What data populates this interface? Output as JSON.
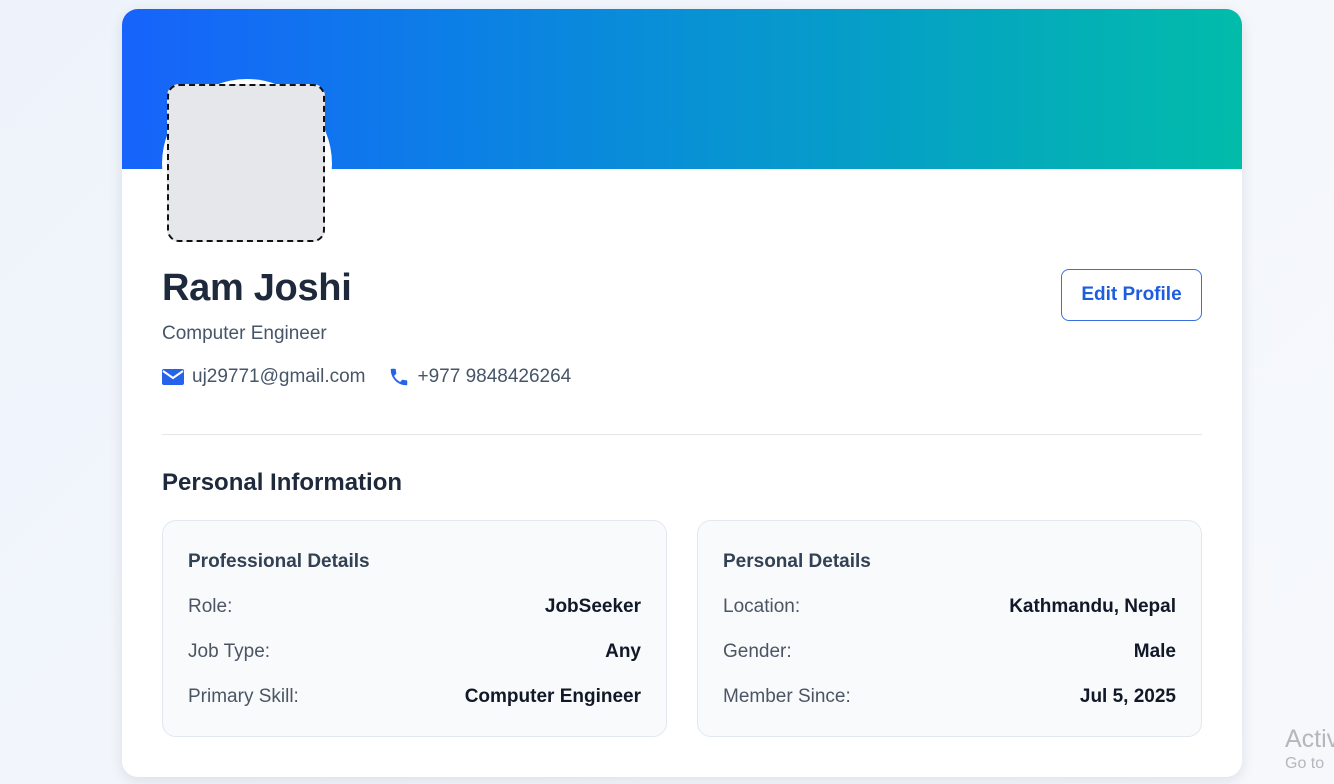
{
  "profile": {
    "name": "Ram Joshi",
    "title": "Computer Engineer",
    "email": "uj29771@gmail.com",
    "phone": "+977 9848426264",
    "edit_label": "Edit Profile"
  },
  "section": {
    "title": "Personal Information"
  },
  "professional": {
    "title": "Professional Details",
    "rows": [
      {
        "label": "Role:",
        "value": "JobSeeker"
      },
      {
        "label": "Job Type:",
        "value": "Any"
      },
      {
        "label": "Primary Skill:",
        "value": "Computer Engineer"
      }
    ]
  },
  "personal": {
    "title": "Personal Details",
    "rows": [
      {
        "label": "Location:",
        "value": "Kathmandu, Nepal"
      },
      {
        "label": "Gender:",
        "value": "Male"
      },
      {
        "label": "Member Since:",
        "value": "Jul 5, 2025"
      }
    ]
  },
  "watermark": {
    "line1": "Activ",
    "line2": "Go to"
  },
  "icons": {
    "email": "mail-icon",
    "phone": "phone-icon"
  },
  "colors": {
    "accent": "#1d5ee0",
    "banner_start": "#1763fb",
    "banner_end": "#02bcaa",
    "icon": "#2563eb"
  }
}
